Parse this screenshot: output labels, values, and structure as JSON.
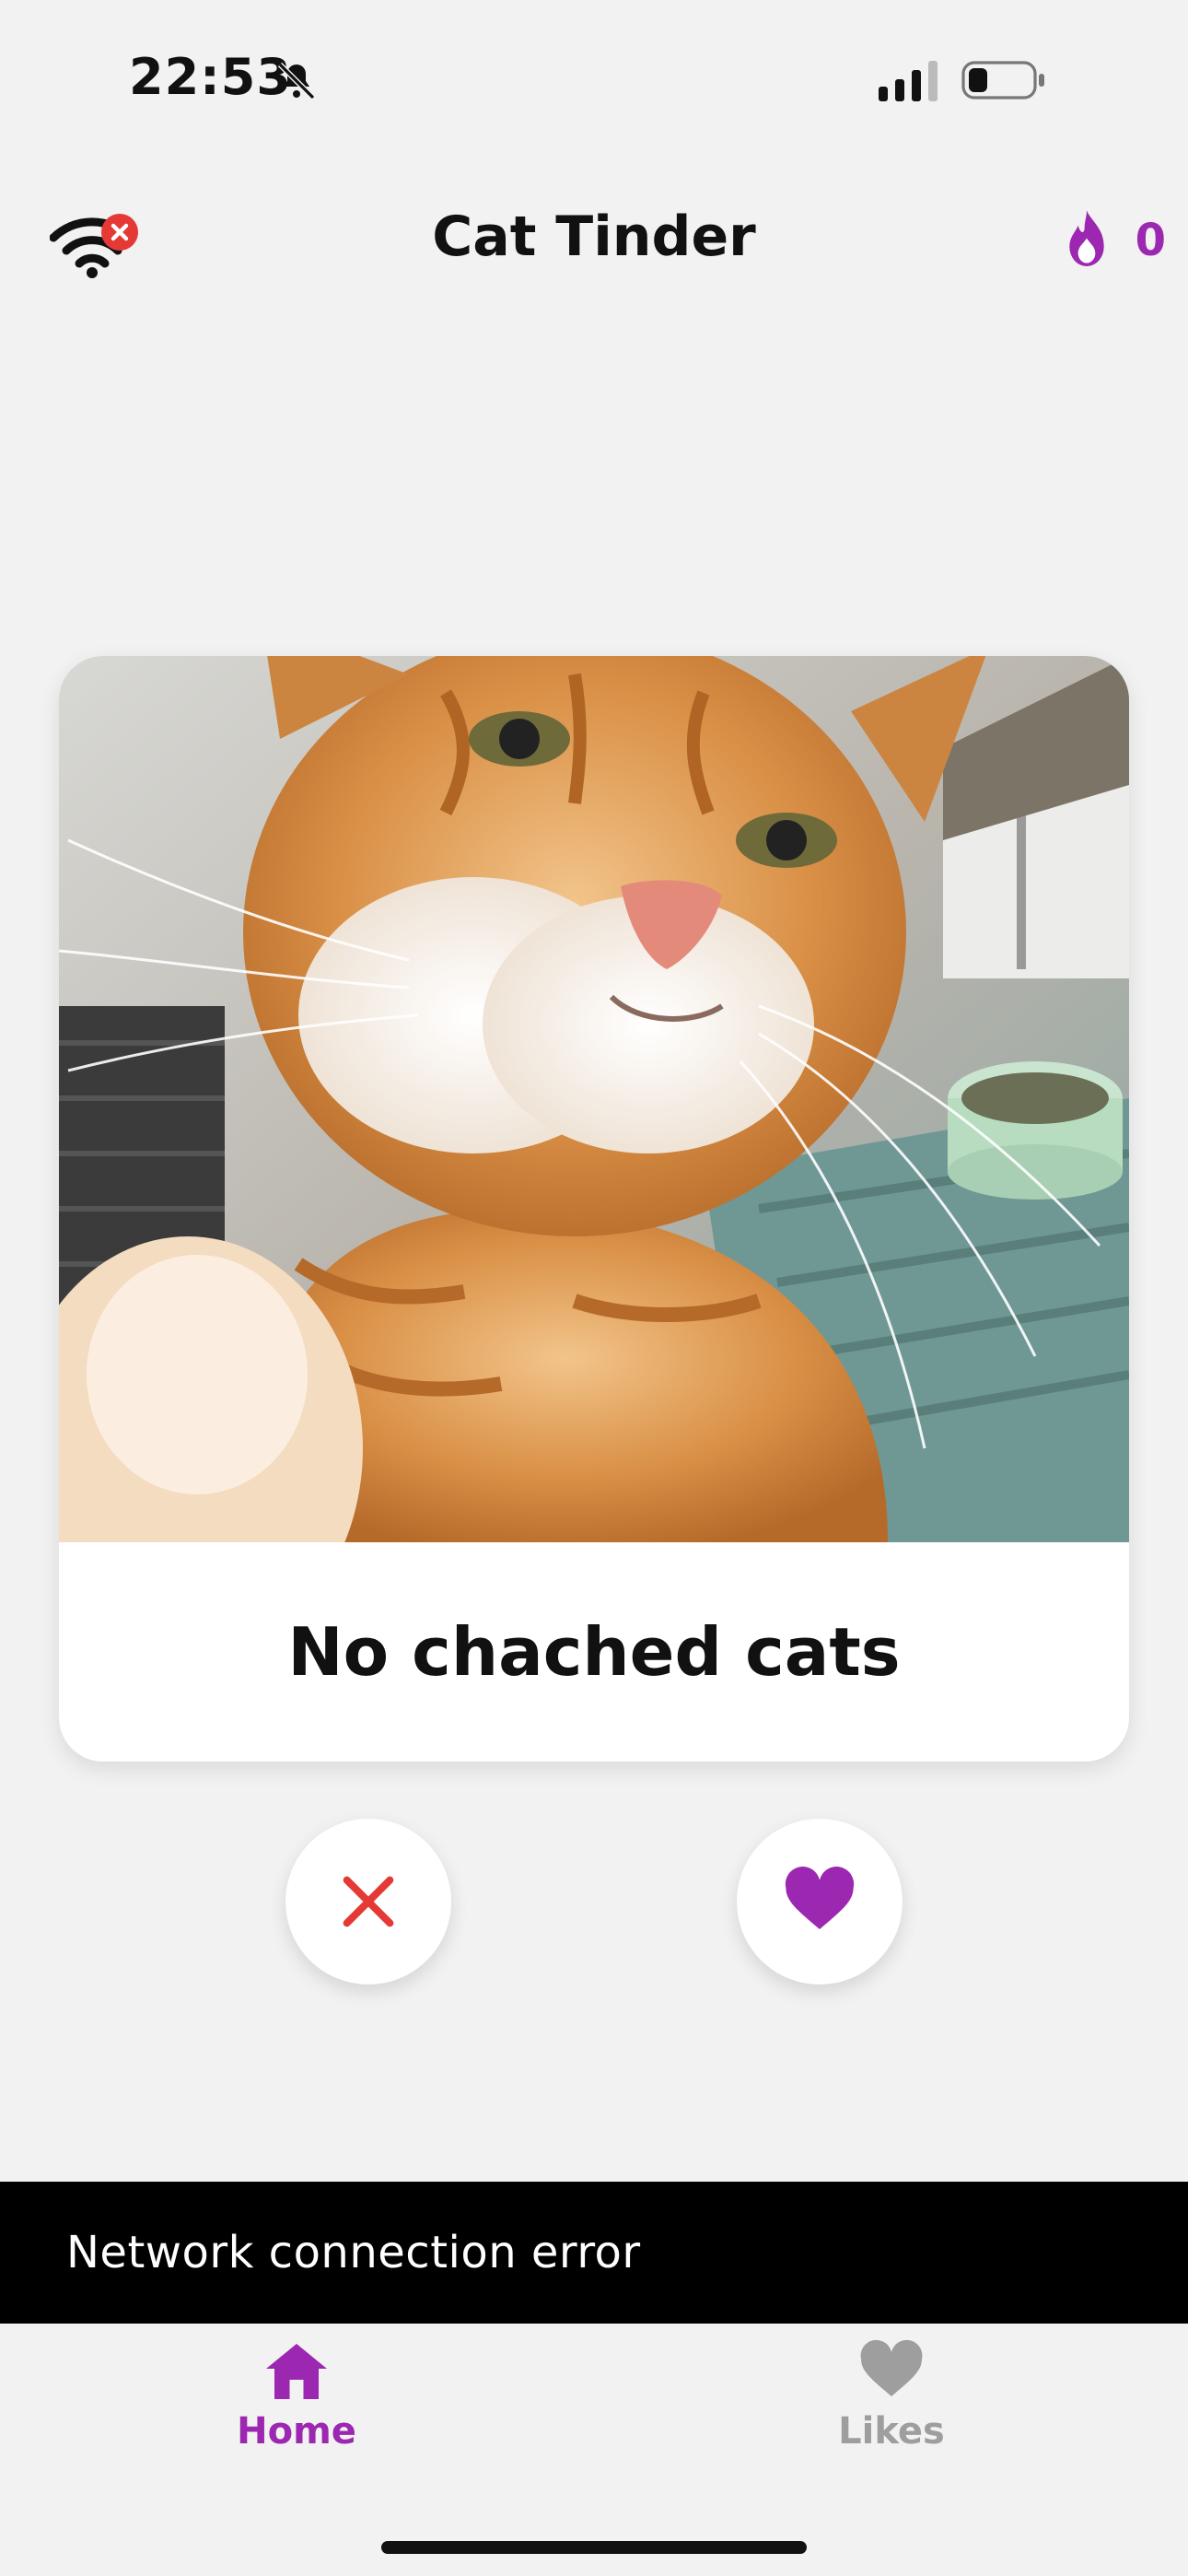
{
  "status_bar": {
    "time": "22:53",
    "icons": [
      "bell-slash-icon",
      "cellular-signal-icon",
      "battery-icon"
    ]
  },
  "header": {
    "title": "Cat Tinder",
    "offline_icon": "wifi-error-icon",
    "streak_icon": "flame-icon",
    "streak_count": "0"
  },
  "card": {
    "image_alt": "orange tabby cat",
    "caption": "No chached cats"
  },
  "actions": {
    "dislike_icon": "close-icon",
    "like_icon": "heart-icon"
  },
  "snackbar": {
    "message": "Network connection error"
  },
  "bottom_nav": {
    "items": [
      {
        "label": "Home",
        "icon": "home-icon",
        "active": true
      },
      {
        "label": "Likes",
        "icon": "heart-icon",
        "active": false
      }
    ]
  },
  "colors": {
    "accent": "#9c27b0",
    "error": "#e53935",
    "background": "#f2f2f2",
    "snackbar": "#000000",
    "inactive": "#9e9e9e"
  }
}
